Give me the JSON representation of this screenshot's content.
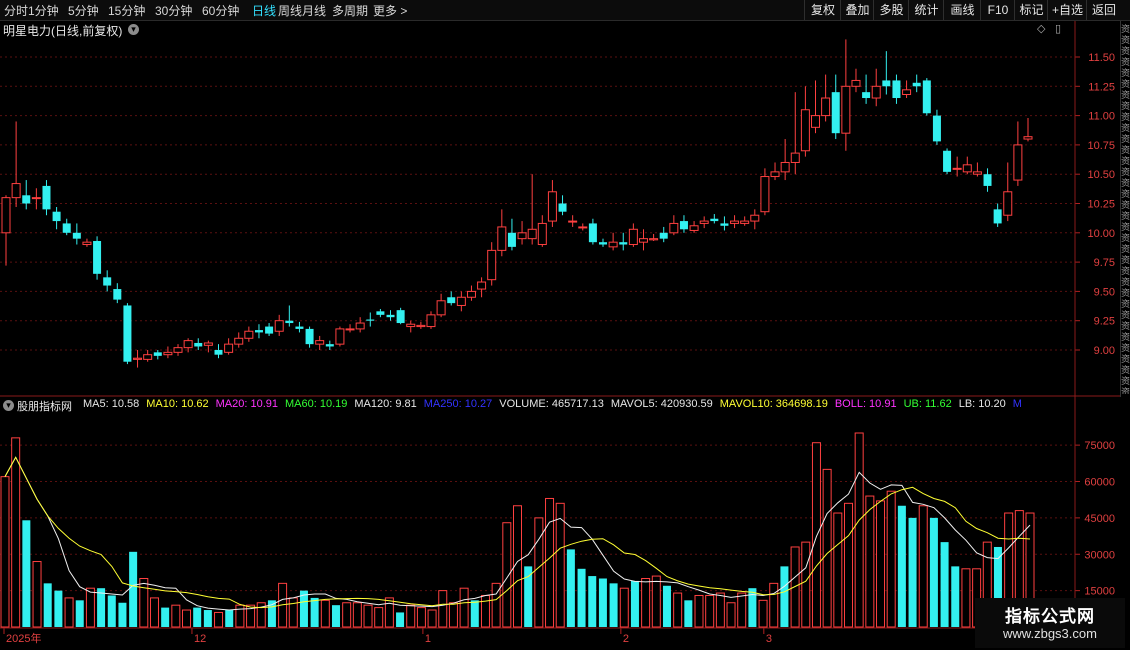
{
  "periods": [
    {
      "label": "分时"
    },
    {
      "label": "1分钟"
    },
    {
      "label": "5分钟"
    },
    {
      "label": "15分钟"
    },
    {
      "label": "30分钟"
    },
    {
      "label": "60分钟"
    },
    {
      "label": "日线",
      "active": true
    },
    {
      "label": "周线"
    },
    {
      "label": "月线"
    },
    {
      "label": "多周期"
    },
    {
      "label": "更多 >"
    }
  ],
  "toolbar": {
    "buttons": [
      {
        "label": "复权"
      },
      {
        "label": "叠加"
      },
      {
        "label": "多股"
      },
      {
        "label": "统计"
      },
      {
        "label": "画线"
      },
      {
        "label": "F10"
      },
      {
        "label": "标记"
      },
      {
        "label": "+自选"
      },
      {
        "label": "返回"
      }
    ]
  },
  "stock": {
    "title": "明星电力(日线,前复权)",
    "dropdown_icon": "chevron-down-icon",
    "icons": {
      "diamond": "◇",
      "panel": "▯"
    }
  },
  "right_panel_text": "资资资资资资资资资资资资资资资资资资资资资资资资资资资资资资资资资资资资资资资资资资资资资资资资资",
  "indicator": {
    "name": "股朋指标网",
    "values": [
      {
        "text": "MA5: 10.58",
        "color": "#e6e6e6"
      },
      {
        "text": "MA10: 10.62",
        "color": "#ffff33"
      },
      {
        "text": "MA20: 10.91",
        "color": "#ff33ff"
      },
      {
        "text": "MA60: 10.19",
        "color": "#33ff33"
      },
      {
        "text": "MA120: 9.81",
        "color": "#e6e6e6"
      },
      {
        "text": "MA250: 10.27",
        "color": "#3333ff"
      },
      {
        "text": "VOLUME: 465717.13",
        "color": "#e6e6e6"
      },
      {
        "text": "MAVOL5: 420930.59",
        "color": "#e6e6e6"
      },
      {
        "text": "MAVOL10: 364698.19",
        "color": "#ffff33"
      },
      {
        "text": "BOLL: 10.91",
        "color": "#ff33ff"
      },
      {
        "text": "UB: 11.62",
        "color": "#33ff33"
      },
      {
        "text": "LB: 10.20",
        "color": "#e6e6e6"
      },
      {
        "text": "M",
        "color": "#3333ff"
      }
    ]
  },
  "watermark": {
    "line1": "指标公式网",
    "line2": "www.zbgs3.com"
  },
  "chart_data": {
    "type": "candlestick",
    "price_axis": {
      "ticks": [
        9.0,
        9.25,
        9.5,
        9.75,
        10.0,
        10.25,
        10.5,
        10.75,
        11.0,
        11.25,
        11.5
      ]
    },
    "volume_axis": {
      "ticks": [
        15000,
        30000,
        45000,
        60000,
        75000
      ]
    },
    "date_labels": [
      {
        "label": "2025年",
        "index": 0
      },
      {
        "label": "12",
        "index": 17
      },
      {
        "label": "1",
        "index": 38
      },
      {
        "label": "2",
        "index": 56
      },
      {
        "label": "3",
        "index": 69
      }
    ],
    "candles": [
      [
        10.0,
        10.32,
        9.72,
        10.3,
        10.0
      ],
      [
        10.3,
        10.48,
        10.22,
        10.42,
        10.95
      ],
      [
        10.32,
        10.45,
        10.2,
        10.25,
        10.4
      ],
      [
        10.3,
        10.38,
        10.2,
        10.3,
        10.35
      ],
      [
        10.4,
        10.42,
        10.15,
        10.2,
        10.45
      ],
      [
        10.18,
        10.22,
        10.03,
        10.1,
        10.2
      ],
      [
        10.08,
        10.12,
        9.98,
        10.0,
        10.1
      ],
      [
        10.0,
        10.08,
        9.9,
        9.95,
        10.05
      ],
      [
        9.9,
        9.92,
        9.88,
        9.92,
        9.95
      ],
      [
        9.93,
        9.95,
        9.6,
        9.65,
        9.97
      ],
      [
        9.62,
        9.68,
        9.5,
        9.55,
        9.65
      ],
      [
        9.52,
        9.55,
        9.4,
        9.43,
        9.57
      ],
      [
        9.38,
        9.4,
        8.88,
        8.9,
        9.38
      ],
      [
        8.92,
        8.95,
        8.85,
        8.93,
        9.0
      ],
      [
        8.92,
        8.98,
        8.9,
        8.96,
        9.0
      ],
      [
        8.98,
        9.0,
        8.92,
        8.95,
        9.0
      ],
      [
        8.96,
        9.0,
        8.93,
        8.98,
        9.03
      ],
      [
        8.98,
        9.05,
        8.95,
        9.02,
        9.05
      ],
      [
        9.02,
        9.1,
        8.98,
        9.08,
        9.1
      ],
      [
        9.06,
        9.08,
        9.0,
        9.03,
        9.1
      ],
      [
        9.04,
        9.08,
        8.98,
        9.06,
        9.08
      ],
      [
        9.0,
        9.05,
        8.93,
        8.96,
        9.05
      ],
      [
        8.98,
        9.08,
        8.96,
        9.05,
        9.1
      ],
      [
        9.05,
        9.12,
        9.02,
        9.1,
        9.15
      ],
      [
        9.1,
        9.18,
        9.07,
        9.16,
        9.2
      ],
      [
        9.17,
        9.2,
        9.1,
        9.15,
        9.22
      ],
      [
        9.2,
        9.23,
        9.12,
        9.14,
        9.23
      ],
      [
        9.16,
        9.27,
        9.12,
        9.25,
        9.3
      ],
      [
        9.25,
        9.35,
        9.2,
        9.23,
        9.38
      ],
      [
        9.2,
        9.24,
        9.15,
        9.18,
        9.24
      ],
      [
        9.18,
        9.2,
        9.02,
        9.05,
        9.2
      ],
      [
        9.05,
        9.1,
        9.0,
        9.08,
        9.12
      ],
      [
        9.05,
        9.08,
        9.0,
        9.03,
        9.08
      ],
      [
        9.05,
        9.2,
        9.03,
        9.18,
        9.2
      ],
      [
        9.18,
        9.2,
        9.15,
        9.18,
        9.22
      ],
      [
        9.18,
        9.25,
        9.15,
        9.23,
        9.28
      ],
      [
        9.26,
        9.3,
        9.2,
        9.25,
        9.32
      ],
      [
        9.33,
        9.35,
        9.28,
        9.3,
        9.35
      ],
      [
        9.3,
        9.34,
        9.25,
        9.28,
        9.34
      ],
      [
        9.34,
        9.35,
        9.22,
        9.23,
        9.36
      ],
      [
        9.2,
        9.25,
        9.15,
        9.22,
        9.25
      ],
      [
        9.2,
        9.22,
        9.18,
        9.21,
        9.24
      ],
      [
        9.2,
        9.32,
        9.18,
        9.3,
        9.33
      ],
      [
        9.3,
        9.45,
        9.28,
        9.42,
        9.48
      ],
      [
        9.45,
        9.48,
        9.38,
        9.4,
        9.5
      ],
      [
        9.38,
        9.47,
        9.33,
        9.45,
        9.5
      ],
      [
        9.45,
        9.52,
        9.42,
        9.5,
        9.55
      ],
      [
        9.52,
        9.6,
        9.45,
        9.58,
        9.62
      ],
      [
        9.6,
        9.9,
        9.55,
        9.85,
        9.92
      ],
      [
        9.85,
        10.1,
        9.8,
        10.05,
        10.2
      ],
      [
        10.0,
        10.05,
        9.85,
        9.88,
        10.12
      ],
      [
        9.95,
        10.0,
        9.9,
        10.0,
        10.1
      ],
      [
        9.95,
        10.05,
        9.9,
        10.03,
        10.5
      ],
      [
        9.9,
        10.1,
        9.88,
        10.08,
        10.15
      ],
      [
        10.1,
        10.4,
        10.05,
        10.35,
        10.45
      ],
      [
        10.25,
        10.3,
        10.15,
        10.18,
        10.32
      ],
      [
        10.1,
        10.15,
        10.05,
        10.1,
        10.15
      ],
      [
        10.05,
        10.08,
        10.02,
        10.05,
        10.08
      ],
      [
        10.08,
        10.1,
        9.9,
        9.92,
        10.12
      ],
      [
        9.92,
        9.95,
        9.88,
        9.9,
        9.95
      ],
      [
        9.88,
        9.95,
        9.85,
        9.92,
        10.0
      ],
      [
        9.92,
        9.95,
        9.85,
        9.9,
        10.0
      ],
      [
        9.9,
        10.05,
        9.88,
        10.03,
        10.08
      ],
      [
        9.92,
        9.98,
        9.85,
        9.95,
        10.03
      ],
      [
        9.94,
        9.96,
        9.93,
        9.95,
        9.99
      ],
      [
        10.0,
        10.02,
        9.92,
        9.95,
        10.05
      ],
      [
        10.0,
        10.1,
        9.98,
        10.08,
        10.15
      ],
      [
        10.1,
        10.12,
        10.0,
        10.03,
        10.15
      ],
      [
        10.02,
        10.08,
        10.0,
        10.06,
        10.1
      ],
      [
        10.08,
        10.12,
        10.04,
        10.1,
        10.14
      ],
      [
        10.12,
        10.15,
        10.08,
        10.1,
        10.16
      ],
      [
        10.08,
        10.12,
        10.02,
        10.06,
        10.14
      ],
      [
        10.08,
        10.12,
        10.04,
        10.1,
        10.15
      ],
      [
        10.08,
        10.12,
        10.06,
        10.1,
        10.14
      ],
      [
        10.1,
        10.18,
        10.03,
        10.15,
        10.2
      ],
      [
        10.18,
        10.5,
        10.15,
        10.48,
        10.55
      ],
      [
        10.48,
        10.55,
        10.45,
        10.52,
        10.6
      ],
      [
        10.52,
        10.65,
        10.45,
        10.6,
        10.8
      ],
      [
        10.6,
        10.75,
        10.5,
        10.68,
        11.2
      ],
      [
        10.7,
        11.1,
        10.65,
        11.05,
        11.25
      ],
      [
        10.9,
        11.05,
        10.85,
        11.0,
        11.3
      ],
      [
        11.0,
        11.2,
        10.95,
        11.15,
        11.35
      ],
      [
        11.2,
        11.25,
        10.8,
        10.85,
        11.35
      ],
      [
        10.85,
        11.3,
        10.7,
        11.25,
        11.65
      ],
      [
        11.25,
        11.35,
        11.2,
        11.3,
        11.4
      ],
      [
        11.2,
        11.28,
        11.1,
        11.15,
        11.35
      ],
      [
        11.15,
        11.3,
        11.08,
        11.25,
        11.4
      ],
      [
        11.3,
        11.32,
        11.18,
        11.25,
        11.55
      ],
      [
        11.3,
        11.32,
        11.1,
        11.15,
        11.35
      ],
      [
        11.18,
        11.25,
        11.15,
        11.22,
        11.3
      ],
      [
        11.28,
        11.35,
        11.2,
        11.25,
        11.35
      ],
      [
        11.3,
        11.32,
        11.0,
        11.02,
        11.32
      ],
      [
        11.0,
        11.05,
        10.75,
        10.78,
        11.05
      ],
      [
        10.7,
        10.72,
        10.5,
        10.52,
        10.72
      ],
      [
        10.55,
        10.6,
        10.48,
        10.55,
        10.65
      ],
      [
        10.52,
        10.6,
        10.5,
        10.58,
        10.65
      ],
      [
        10.5,
        10.55,
        10.48,
        10.52,
        10.6
      ],
      [
        10.5,
        10.52,
        10.35,
        10.4,
        10.55
      ],
      [
        10.2,
        10.25,
        10.05,
        10.08,
        10.25
      ],
      [
        10.15,
        10.4,
        10.1,
        10.35,
        10.6
      ],
      [
        10.45,
        10.8,
        10.4,
        10.75,
        10.95
      ],
      [
        10.8,
        10.85,
        10.78,
        10.82,
        10.98
      ]
    ],
    "volumes": [
      {
        "v": 62000,
        "up": true
      },
      {
        "v": 78000,
        "up": true
      },
      {
        "v": 44000,
        "up": false
      },
      {
        "v": 27000,
        "up": true
      },
      {
        "v": 18000,
        "up": false
      },
      {
        "v": 15000,
        "up": false
      },
      {
        "v": 12000,
        "up": true
      },
      {
        "v": 11000,
        "up": false
      },
      {
        "v": 16000,
        "up": true
      },
      {
        "v": 16000,
        "up": false
      },
      {
        "v": 13000,
        "up": false
      },
      {
        "v": 10000,
        "up": false
      },
      {
        "v": 31000,
        "up": false
      },
      {
        "v": 20000,
        "up": true
      },
      {
        "v": 12000,
        "up": true
      },
      {
        "v": 8000,
        "up": false
      },
      {
        "v": 9000,
        "up": true
      },
      {
        "v": 7000,
        "up": true
      },
      {
        "v": 8000,
        "up": false
      },
      {
        "v": 7000,
        "up": false
      },
      {
        "v": 6000,
        "up": true
      },
      {
        "v": 7000,
        "up": false
      },
      {
        "v": 9000,
        "up": true
      },
      {
        "v": 9000,
        "up": true
      },
      {
        "v": 10000,
        "up": true
      },
      {
        "v": 11000,
        "up": false
      },
      {
        "v": 18000,
        "up": true
      },
      {
        "v": 12000,
        "up": true
      },
      {
        "v": 15000,
        "up": false
      },
      {
        "v": 12000,
        "up": false
      },
      {
        "v": 11000,
        "up": true
      },
      {
        "v": 9000,
        "up": false
      },
      {
        "v": 10000,
        "up": true
      },
      {
        "v": 10000,
        "up": true
      },
      {
        "v": 9000,
        "up": true
      },
      {
        "v": 8000,
        "up": true
      },
      {
        "v": 12000,
        "up": true
      },
      {
        "v": 6000,
        "up": false
      },
      {
        "v": 9000,
        "up": true
      },
      {
        "v": 8000,
        "up": true
      },
      {
        "v": 7000,
        "up": true
      },
      {
        "v": 15000,
        "up": true
      },
      {
        "v": 10000,
        "up": true
      },
      {
        "v": 16000,
        "up": true
      },
      {
        "v": 11000,
        "up": false
      },
      {
        "v": 13000,
        "up": true
      },
      {
        "v": 18000,
        "up": true
      },
      {
        "v": 43000,
        "up": true
      },
      {
        "v": 50000,
        "up": true
      },
      {
        "v": 25000,
        "up": false
      },
      {
        "v": 45000,
        "up": true
      },
      {
        "v": 53000,
        "up": true
      },
      {
        "v": 51000,
        "up": true
      },
      {
        "v": 32000,
        "up": false
      },
      {
        "v": 24000,
        "up": false
      },
      {
        "v": 21000,
        "up": false
      },
      {
        "v": 20000,
        "up": false
      },
      {
        "v": 18000,
        "up": false
      },
      {
        "v": 16000,
        "up": true
      },
      {
        "v": 19000,
        "up": false
      },
      {
        "v": 20000,
        "up": true
      },
      {
        "v": 21000,
        "up": true
      },
      {
        "v": 17000,
        "up": false
      },
      {
        "v": 14000,
        "up": true
      },
      {
        "v": 11000,
        "up": false
      },
      {
        "v": 13000,
        "up": true
      },
      {
        "v": 13000,
        "up": true
      },
      {
        "v": 14000,
        "up": true
      },
      {
        "v": 10000,
        "up": true
      },
      {
        "v": 14000,
        "up": true
      },
      {
        "v": 16000,
        "up": false
      },
      {
        "v": 11000,
        "up": true
      },
      {
        "v": 18000,
        "up": true
      },
      {
        "v": 25000,
        "up": false
      },
      {
        "v": 33000,
        "up": true
      },
      {
        "v": 35000,
        "up": true
      },
      {
        "v": 76000,
        "up": true
      },
      {
        "v": 65000,
        "up": true
      },
      {
        "v": 47000,
        "up": true
      },
      {
        "v": 51000,
        "up": true
      },
      {
        "v": 80000,
        "up": true
      },
      {
        "v": 54000,
        "up": true
      },
      {
        "v": 52000,
        "up": true
      },
      {
        "v": 56000,
        "up": true
      },
      {
        "v": 50000,
        "up": false
      },
      {
        "v": 45000,
        "up": false
      },
      {
        "v": 50000,
        "up": true
      },
      {
        "v": 45000,
        "up": false
      },
      {
        "v": 35000,
        "up": false
      },
      {
        "v": 25000,
        "up": false
      },
      {
        "v": 24000,
        "up": true
      },
      {
        "v": 24000,
        "up": true
      },
      {
        "v": 35000,
        "up": true
      },
      {
        "v": 33000,
        "up": false
      },
      {
        "v": 47000,
        "up": true
      },
      {
        "v": 48000,
        "up": true
      },
      {
        "v": 47000,
        "up": true
      }
    ]
  }
}
